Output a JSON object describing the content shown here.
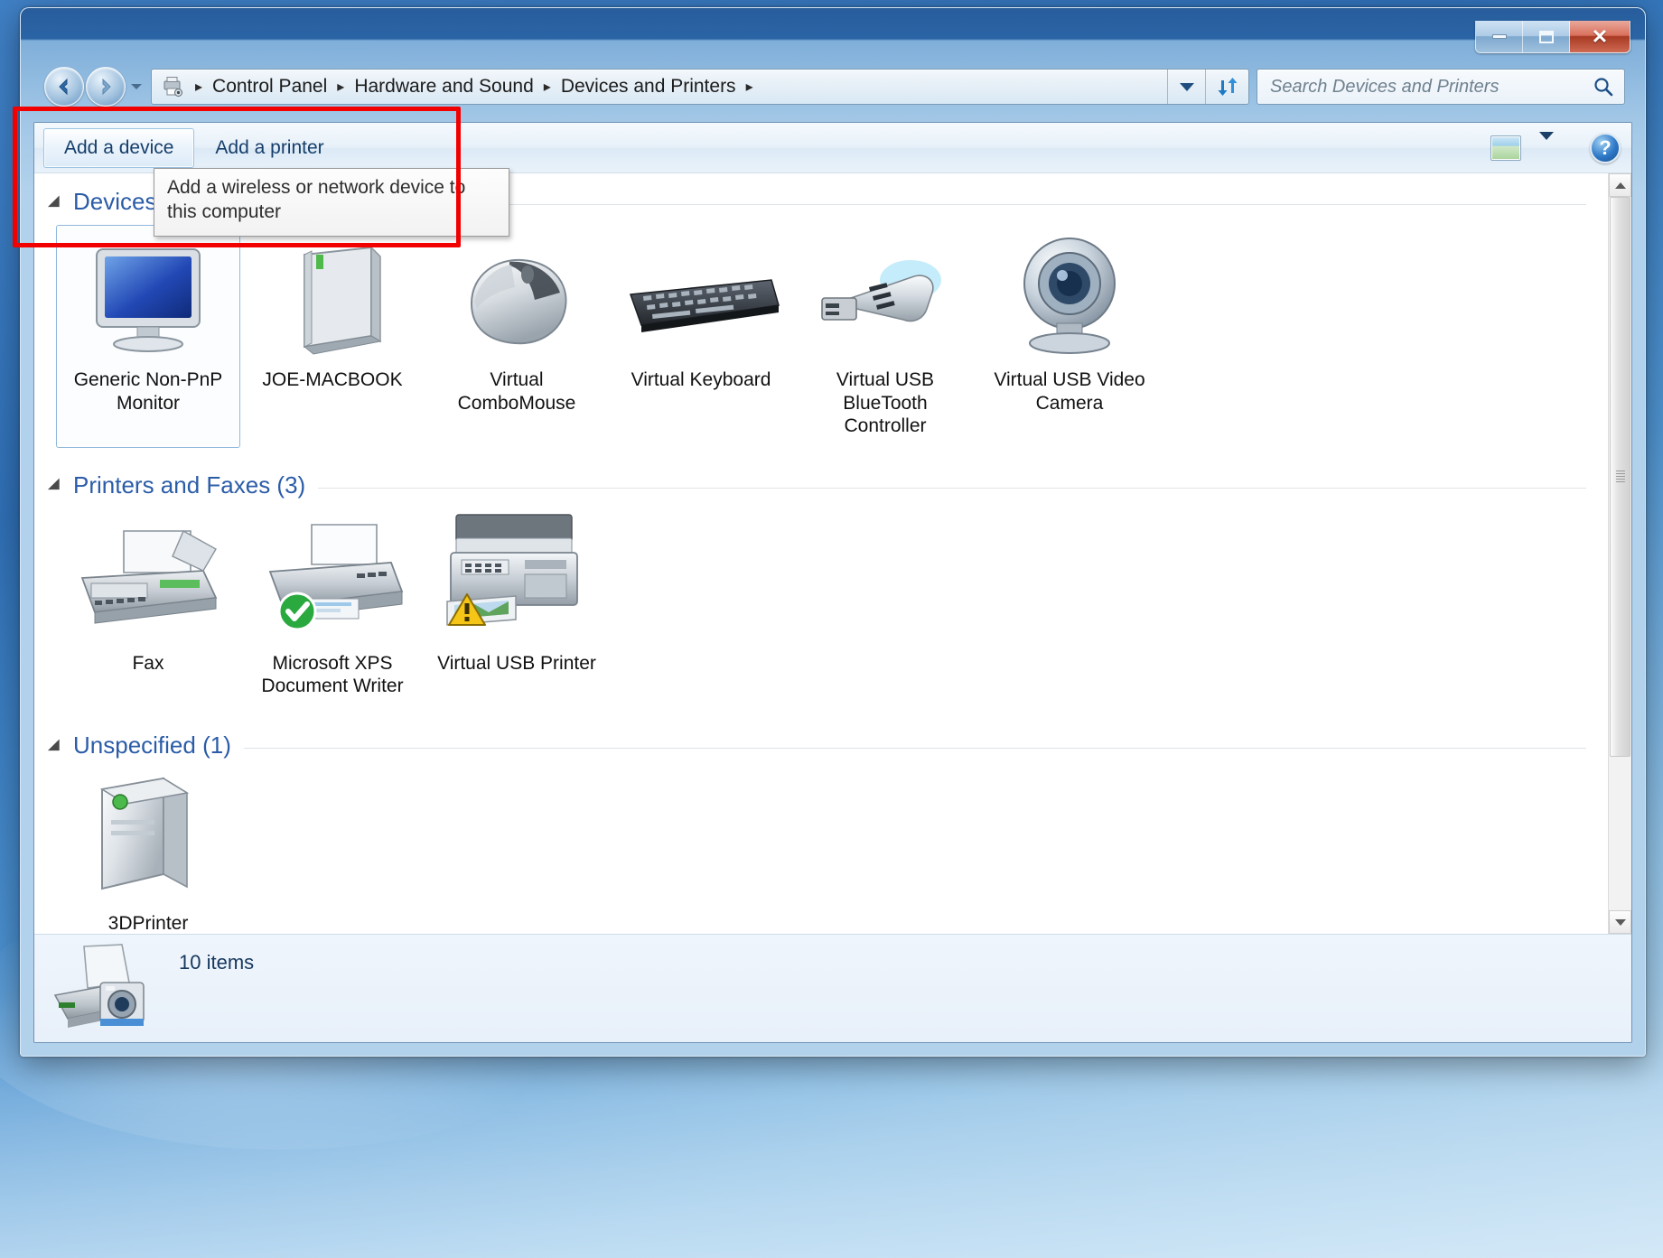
{
  "window": {
    "controls": {
      "minimize": "minimize-button",
      "maximize": "maximize-button",
      "close": "close-button"
    }
  },
  "address_bar": {
    "icon": "devices-and-printers-icon",
    "breadcrumbs": [
      "Control Panel",
      "Hardware and Sound",
      "Devices and Printers"
    ],
    "separator": "▸",
    "dropdown": "address-history-dropdown",
    "refresh": "refresh-button"
  },
  "search": {
    "placeholder": "Search Devices and Printers",
    "value": "",
    "icon": "search-icon"
  },
  "command_bar": {
    "add_device_label": "Add a device",
    "add_printer_label": "Add a printer",
    "view_icon": "change-view-icon",
    "view_caret": "change-view-dropdown",
    "help_label": "?"
  },
  "tooltip": {
    "text": "Add a wireless or network device to this computer"
  },
  "sections": [
    {
      "title": "Devices (6)",
      "items": [
        {
          "label": "Generic Non-PnP Monitor",
          "icon": "monitor-icon",
          "selected": true
        },
        {
          "label": "JOE-MACBOOK",
          "icon": "computer-icon",
          "selected": false
        },
        {
          "label": "Virtual ComboMouse",
          "icon": "mouse-icon",
          "selected": false
        },
        {
          "label": "Virtual Keyboard",
          "icon": "keyboard-icon",
          "selected": false
        },
        {
          "label": "Virtual USB BlueTooth Controller",
          "icon": "usb-bluetooth-icon",
          "selected": false
        },
        {
          "label": "Virtual USB Video Camera",
          "icon": "webcam-icon",
          "selected": false
        }
      ]
    },
    {
      "title": "Printers and Faxes (3)",
      "items": [
        {
          "label": "Fax",
          "icon": "fax-icon",
          "selected": false
        },
        {
          "label": "Microsoft XPS Document Writer",
          "icon": "printer-default-icon",
          "selected": false
        },
        {
          "label": "Virtual USB Printer",
          "icon": "printer-warning-icon",
          "selected": false
        }
      ]
    },
    {
      "title": "Unspecified (1)",
      "items": [
        {
          "label": "3DPrinter",
          "icon": "unspecified-device-icon",
          "selected": false
        }
      ]
    }
  ],
  "status_bar": {
    "icon": "printer-camera-icon",
    "text": "10 items"
  },
  "scrollbar": {
    "up": "scroll-up-button",
    "down": "scroll-down-button",
    "thumb": "scroll-thumb"
  },
  "colors": {
    "accent": "#2b5ca8",
    "annotation": "#f20000",
    "titlebar": "#1e5596"
  }
}
